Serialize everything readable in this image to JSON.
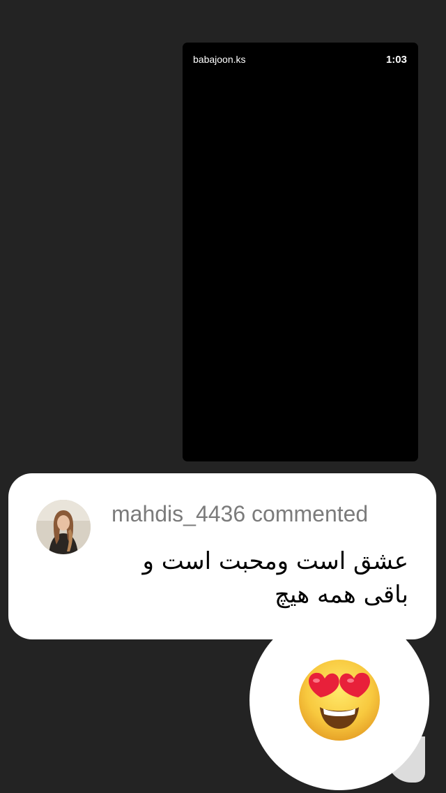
{
  "video": {
    "username": "babajoon.ks",
    "time": "1:03"
  },
  "comment": {
    "username": "mahdis_4436",
    "action": "commented",
    "header": "mahdis_4436 commented",
    "text": "عشق است ومحبت است و باقی همه هیچ"
  },
  "reaction": {
    "emoji": "heart-eyes",
    "icon": "heart-eyes-emoji-icon"
  },
  "colors": {
    "background": "#232323",
    "card": "#ffffff",
    "header_text": "#7b7b7b",
    "emoji_face": "#f7c545",
    "emoji_hearts": "#e8203a"
  }
}
